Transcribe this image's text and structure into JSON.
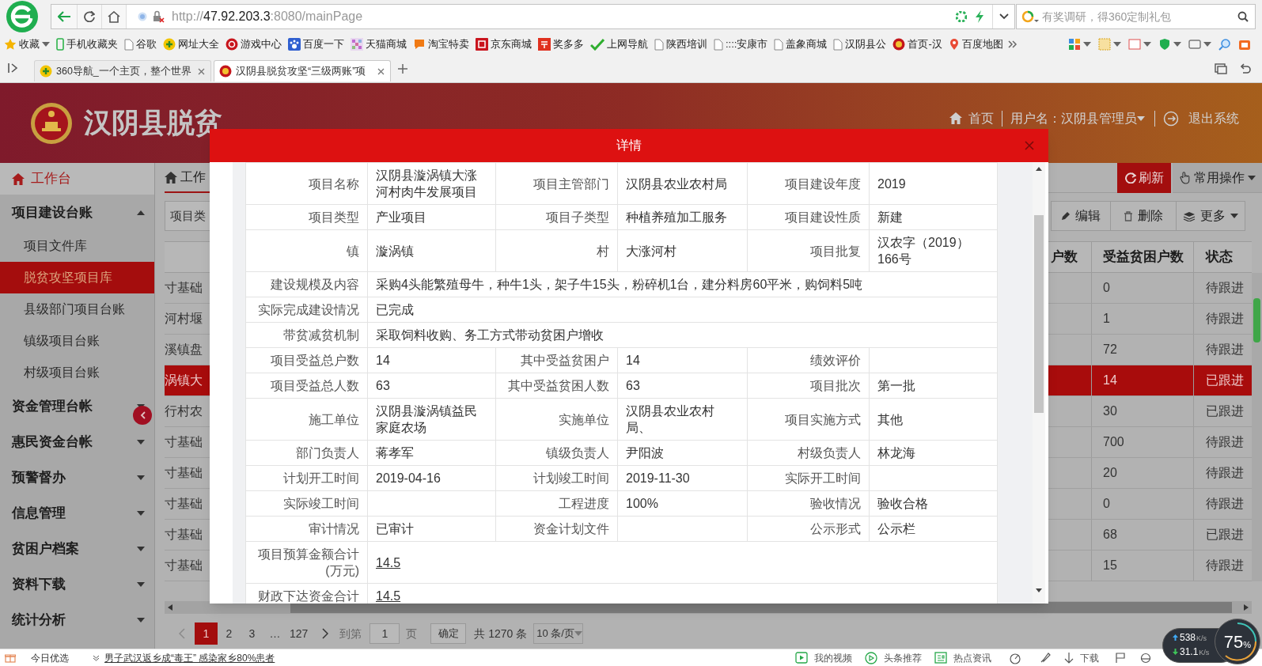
{
  "browser": {
    "address": {
      "prefix": "http://",
      "host": "47.92.203.3",
      "rest": ":8080/mainPage"
    },
    "search_placeholder": "有奖调研，得360定制礼包",
    "bookmarks": [
      {
        "label": "收藏",
        "dropdown": true
      },
      {
        "label": "手机收藏夹",
        "dropdown": false
      },
      {
        "label": "谷歌",
        "dropdown": false
      },
      {
        "label": "网址大全",
        "dropdown": false
      },
      {
        "label": "游戏中心",
        "dropdown": false
      },
      {
        "label": "百度一下",
        "dropdown": false
      },
      {
        "label": "天猫商城",
        "dropdown": false
      },
      {
        "label": "淘宝特卖",
        "dropdown": false
      },
      {
        "label": "京东商城",
        "dropdown": false
      },
      {
        "label": "奖多多",
        "dropdown": false
      },
      {
        "label": "上网导航",
        "dropdown": false
      },
      {
        "label": "陕西培训",
        "dropdown": false
      },
      {
        "label": "::::安康市",
        "dropdown": false
      },
      {
        "label": "盖象商城",
        "dropdown": false
      },
      {
        "label": "汉阴县公",
        "dropdown": false
      },
      {
        "label": "首页-汉",
        "dropdown": false
      },
      {
        "label": "百度地图",
        "dropdown": false
      }
    ],
    "tabs": [
      {
        "title": "360导航_一个主页，整个世界",
        "selected": false
      },
      {
        "title": "汉阴县脱贫攻坚“三级两账”项",
        "selected": true
      }
    ]
  },
  "header": {
    "title": "汉阴县脱贫",
    "home": "首页",
    "user": "用户名：汉阴县管理员",
    "logout": "退出系统"
  },
  "sidebar": {
    "items": [
      {
        "label": "工作台",
        "kind": "home"
      },
      {
        "label": "项目建设台账",
        "kind": "group",
        "expanded": true,
        "children": [
          {
            "label": "项目文件库",
            "selected": false
          },
          {
            "label": "脱贫攻坚项目库",
            "selected": true
          },
          {
            "label": "县级部门项目台账",
            "selected": false
          },
          {
            "label": "镇级项目台账",
            "selected": false
          },
          {
            "label": "村级项目台账",
            "selected": false
          }
        ]
      },
      {
        "label": "资金管理台帐",
        "kind": "group",
        "expanded": false
      },
      {
        "label": "惠民资金台帐",
        "kind": "group",
        "expanded": false
      },
      {
        "label": "预警督办",
        "kind": "group",
        "expanded": false
      },
      {
        "label": "信息管理",
        "kind": "group",
        "expanded": false
      },
      {
        "label": "贫困户档案",
        "kind": "group",
        "expanded": false
      },
      {
        "label": "资料下载",
        "kind": "group",
        "expanded": false
      },
      {
        "label": "统计分析",
        "kind": "group",
        "expanded": false
      }
    ]
  },
  "workspace": {
    "tab": "工作",
    "refresh": "刷新",
    "common_ops": "常用操作",
    "filter": "项目类",
    "actions": [
      "编辑",
      "删除",
      "更多"
    ],
    "table": {
      "columns": [
        "户数",
        "受益贫困户数",
        "状态"
      ],
      "rows": [
        {
          "column_1": "寸基础",
          "poor_households": "0",
          "status": "待跟进",
          "selected": false
        },
        {
          "column_1": "河村堰",
          "poor_households": "1",
          "status": "待跟进",
          "selected": false
        },
        {
          "column_1": "溪镇盘",
          "poor_households": "72",
          "status": "待跟进",
          "selected": false
        },
        {
          "column_1": "涡镇大",
          "poor_households": "14",
          "status": "已跟进",
          "selected": true
        },
        {
          "column_1": "行村农",
          "poor_households": "30",
          "status": "已跟进",
          "selected": false
        },
        {
          "column_1": "寸基础",
          "poor_households": "700",
          "status": "待跟进",
          "selected": false
        },
        {
          "column_1": "寸基础",
          "poor_households": "20",
          "status": "待跟进",
          "selected": false
        },
        {
          "column_1": "寸基础",
          "poor_households": "0",
          "status": "待跟进",
          "selected": false
        },
        {
          "column_1": "寸基础",
          "poor_households": "68",
          "status": "已跟进",
          "selected": false
        },
        {
          "column_1": "寸基础",
          "poor_households": "15",
          "status": "待跟进",
          "selected": false
        }
      ]
    },
    "pagination": {
      "pages": [
        {
          "label": "1",
          "selected": true
        },
        {
          "label": "2",
          "selected": false
        },
        {
          "label": "3",
          "selected": false
        },
        {
          "label": "…",
          "selected": false
        },
        {
          "label": "127",
          "selected": false
        }
      ],
      "goto": "到第",
      "goto_value": "1",
      "unit": "页",
      "confirm": "确定",
      "total": "共 1270 条",
      "page_size": "10 条/页"
    }
  },
  "dialog": {
    "title": "详情",
    "rows": [
      {
        "kind": "triple",
        "cells": [
          {
            "label": "项目名称",
            "value": "汉阴县漩涡镇大涨河村肉牛发展项目"
          },
          {
            "label": "项目主管部门",
            "value": "汉阴县农业农村局"
          },
          {
            "label": "项目建设年度",
            "value": "2019"
          }
        ]
      },
      {
        "kind": "triple",
        "cells": [
          {
            "label": "项目类型",
            "value": "产业项目"
          },
          {
            "label": "项目子类型",
            "value": "种植养殖加工服务"
          },
          {
            "label": "项目建设性质",
            "value": "新建"
          }
        ]
      },
      {
        "kind": "triple",
        "cells": [
          {
            "label": "镇",
            "value": "漩涡镇"
          },
          {
            "label": "村",
            "value": "大涨河村"
          },
          {
            "label": "项目批复",
            "value": "汉农字（2019）166号"
          }
        ]
      },
      {
        "kind": "wide",
        "cells": [
          {
            "label": "建设规模及内容",
            "value": "采购4头能繁殖母牛，种牛1头，架子牛15头，粉碎机1台，建分料房60平米，购饲料5吨"
          }
        ]
      },
      {
        "kind": "wide",
        "cells": [
          {
            "label": "实际完成建设情况",
            "value": "已完成"
          }
        ]
      },
      {
        "kind": "wide",
        "cells": [
          {
            "label": "带贫减贫机制",
            "value": "采取饲料收购、务工方式带动贫困户增收"
          }
        ]
      },
      {
        "kind": "triple",
        "cells": [
          {
            "label": "项目受益总户数",
            "value": "14"
          },
          {
            "label": "其中受益贫困户",
            "value": "14"
          },
          {
            "label": "绩效评价"
          }
        ]
      },
      {
        "kind": "triple",
        "cells": [
          {
            "label": "项目受益总人数",
            "value": "63"
          },
          {
            "label": "其中受益贫困人数",
            "value": "63"
          },
          {
            "label": "项目批次",
            "value": "第一批"
          }
        ]
      },
      {
        "kind": "triple",
        "cells": [
          {
            "label": "施工单位",
            "value": "汉阴县漩涡镇益民家庭农场"
          },
          {
            "label": "实施单位",
            "value": "汉阴县农业农村局、"
          },
          {
            "label": "项目实施方式",
            "value": "其他"
          }
        ]
      },
      {
        "kind": "triple",
        "cells": [
          {
            "label": "部门负责人",
            "value": "蒋孝军"
          },
          {
            "label": "镇级负责人",
            "value": "尹阳波"
          },
          {
            "label": "村级负责人",
            "value": "林龙海"
          }
        ]
      },
      {
        "kind": "triple",
        "cells": [
          {
            "label": "计划开工时间",
            "value": "2019-04-16"
          },
          {
            "label": "计划竣工时间",
            "value": "2019-11-30"
          },
          {
            "label": "实际开工时间"
          }
        ]
      },
      {
        "kind": "triple",
        "cells": [
          {
            "label": "实际竣工时间"
          },
          {
            "label": "工程进度",
            "value": "100%"
          },
          {
            "label": "验收情况",
            "value": "验收合格"
          }
        ]
      },
      {
        "kind": "triple",
        "cells": [
          {
            "label": "审计情况",
            "value": "已审计"
          },
          {
            "label": "资金计划文件"
          },
          {
            "label": "公示形式",
            "value": "公示栏"
          }
        ]
      },
      {
        "kind": "link",
        "cells": [
          {
            "label": "项目预算金额合计(万元)",
            "value": "14.5"
          }
        ]
      },
      {
        "kind": "link",
        "cells": [
          {
            "label": "财政下达资金合计",
            "value": "14.5"
          }
        ]
      }
    ]
  },
  "status_bar": {
    "today": "今日优选",
    "news": "男子武汉返乡成“毒王” 感染家乡80%患者",
    "items": [
      "我的视频",
      "头条推荐",
      "热点资讯",
      "下载"
    ],
    "speed": {
      "up": "538",
      "up_unit": "K/s",
      "down": "31.1",
      "down_unit": "K/s",
      "percent": "75",
      "percent_sign": "%"
    }
  }
}
